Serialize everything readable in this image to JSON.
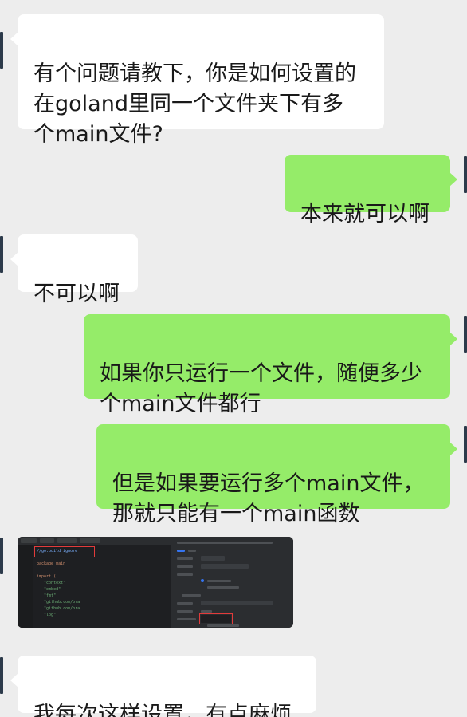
{
  "messages": [
    {
      "side": "in",
      "text": "有个问题请教下，你是如何设置的\n在goland里同一个文件夹下有多\n个main文件?"
    },
    {
      "side": "out",
      "text": "本来就可以啊"
    },
    {
      "side": "in",
      "text": "不可以啊"
    },
    {
      "side": "out",
      "text": "如果你只运行一个文件，随便多少\n个main文件都行"
    },
    {
      "side": "out",
      "text": "但是如果要运行多个main文件，\n那就只能有一个main函数"
    },
    {
      "side": "in",
      "type": "image",
      "alt": "goland screenshot"
    },
    {
      "side": "in",
      "text": "我每次这样设置，有点麻烦"
    }
  ],
  "screenshot": {
    "code_lines": [
      "//go:build ignore",
      "",
      "package main",
      "",
      "import (",
      "   \"context\"",
      "   \"embed\"",
      "   \"fmt\"",
      "   \"github.com/bra",
      "   \"github.com/bra",
      "   \"log\""
    ]
  },
  "colors": {
    "background": "#ededed",
    "incoming_bubble": "#ffffff",
    "outgoing_bubble": "#95ec69",
    "text": "#191919"
  }
}
